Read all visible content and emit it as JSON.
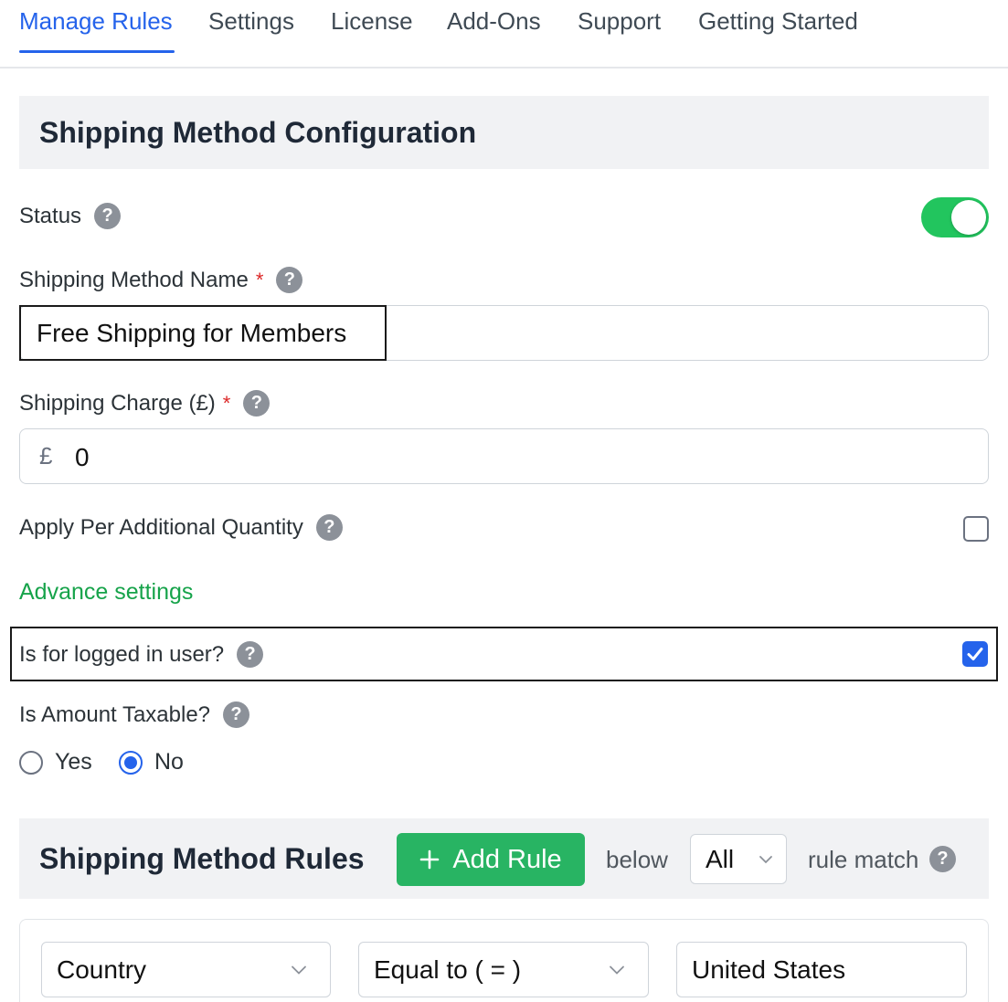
{
  "tabs": [
    {
      "label": "Manage Rules",
      "active": true
    },
    {
      "label": "Settings",
      "active": false
    },
    {
      "label": "License",
      "active": false
    },
    {
      "label": "Add-Ons",
      "active": false
    },
    {
      "label": "Support",
      "active": false
    },
    {
      "label": "Getting Started",
      "active": false
    }
  ],
  "config": {
    "title": "Shipping Method Configuration",
    "status_label": "Status",
    "status_on": true,
    "name_label": "Shipping Method Name",
    "name_required": "*",
    "name_value": "Free Shipping for Members",
    "charge_label": "Shipping Charge (£)",
    "charge_required": "*",
    "currency_symbol": "£",
    "charge_value": "0",
    "per_qty_label": "Apply Per Additional Quantity",
    "per_qty_checked": false,
    "advance_label": "Advance settings",
    "logged_in_label": "Is for logged in user?",
    "logged_in_checked": true,
    "taxable_label": "Is Amount Taxable?",
    "taxable_yes": "Yes",
    "taxable_no": "No",
    "taxable_selected": "No",
    "help_glyph": "?"
  },
  "rules": {
    "title": "Shipping Method Rules",
    "add_rule_label": "Add Rule",
    "add_rule_icon": "plus-icon",
    "below_text": "below",
    "match_value": "All",
    "rule_match_text": "rule match",
    "rows": [
      {
        "field": "Country",
        "operator": "Equal to ( = )",
        "value": "United States"
      }
    ]
  },
  "colors": {
    "accent_blue": "#2563eb",
    "toggle_green": "#22c55e",
    "add_rule_green": "#28b463",
    "advance_green": "#16a34a",
    "required_red": "#dc2626"
  }
}
